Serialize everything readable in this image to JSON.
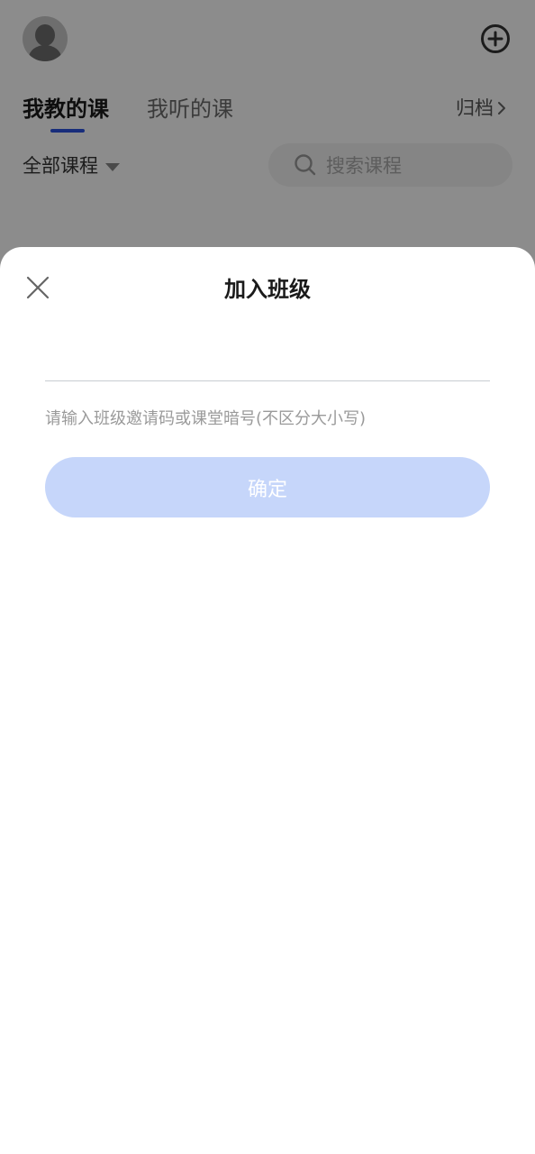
{
  "header": {
    "avatar_icon": "avatar-icon",
    "add_icon": "plus-circle-icon"
  },
  "tabs": {
    "teach_label": "我教的课",
    "listen_label": "我听的课",
    "archive_label": "归档"
  },
  "filter": {
    "selected": "全部课程"
  },
  "search": {
    "placeholder": "搜索课程"
  },
  "dialog": {
    "title": "加入班级",
    "input_value": "",
    "hint": "请输入班级邀请码或课堂暗号(不区分大小写)",
    "confirm_label": "确定"
  },
  "colors": {
    "accent": "#2d53e0",
    "confirm_disabled": "#c6d6fa"
  }
}
